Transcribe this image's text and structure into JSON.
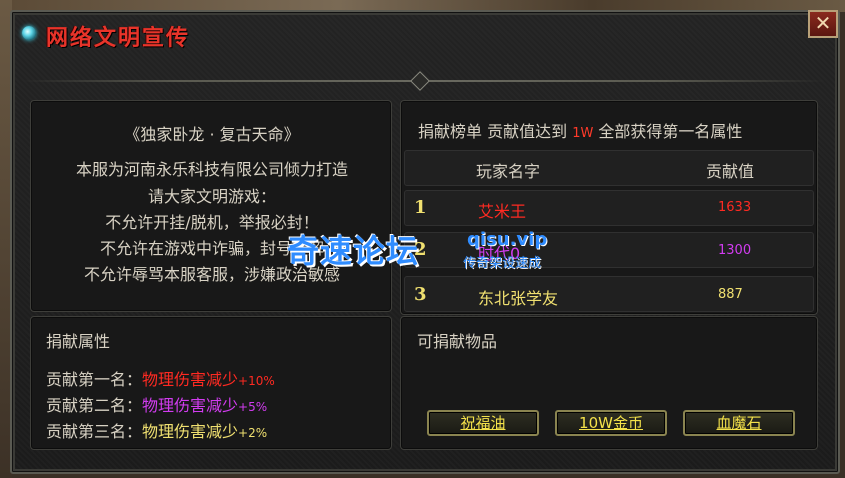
{
  "window": {
    "title": "网络文明宣传",
    "close_label": "✕"
  },
  "intro": {
    "lines": [
      "《独家卧龙 · 复古天命》",
      "本服为河南永乐科技有限公司倾力打造",
      "请大家文明游戏：",
      "不允许开挂/脱机，举报必封！",
      "不允许在游戏中诈骗，封号不解",
      "不允许辱骂本服客服，涉嫌政治敏感"
    ]
  },
  "ranking": {
    "header_prefix": "捐献榜单  贡献值达到",
    "threshold": "1W",
    "header_suffix": "全部获得第一名属性",
    "col_name": "玩家名字",
    "col_value": "贡献值",
    "rows": [
      {
        "rank": "1",
        "name": "艾米王",
        "value": "1633",
        "color": "#ff2a22",
        "value_color": "#ff2a22",
        "rank_color": "#f0e070"
      },
      {
        "rank": "2",
        "name": "时代0",
        "value": "1300",
        "color": "#d23cf0",
        "value_color": "#d23cf0",
        "rank_color": "#f0e070"
      },
      {
        "rank": "3",
        "name": "东北张学友",
        "value": "887",
        "color": "#f0e070",
        "value_color": "#f0e070",
        "rank_color": "#f0e070"
      }
    ]
  },
  "attributes": {
    "title": "捐献属性",
    "items": [
      {
        "label": "贡献第一名：",
        "attr": "物理伤害减少",
        "bonus": "+10%",
        "color": "#ff2a22"
      },
      {
        "label": "贡献第二名：",
        "attr": "物理伤害减少",
        "bonus": "+5%",
        "color": "#d23cf0"
      },
      {
        "label": "贡献第三名：",
        "attr": "物理伤害减少",
        "bonus": "+2%",
        "color": "#f0e070"
      }
    ]
  },
  "donate": {
    "title": "可捐献物品",
    "buttons": [
      "祝福油",
      "10W金币",
      "血魔石"
    ]
  },
  "watermark": {
    "main": "奇速论坛",
    "domain": "qisu.vip",
    "slogan": "传奇架设速成"
  }
}
